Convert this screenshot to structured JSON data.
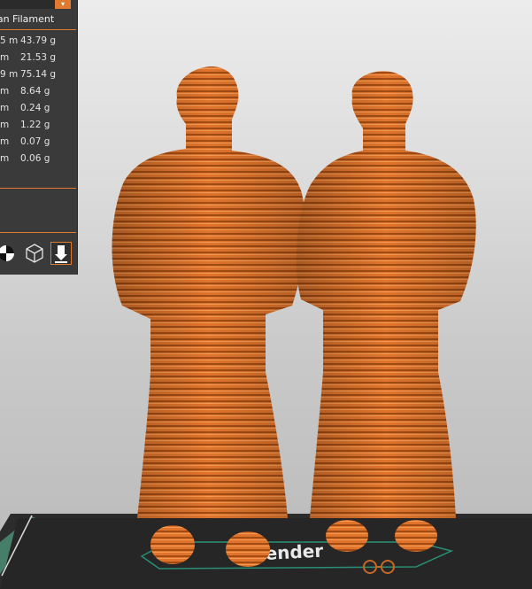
{
  "panel": {
    "title": "Filament",
    "title_prefix": "milan",
    "rows": [
      {
        "length": "5 m",
        "weight": "43.79 g"
      },
      {
        "length": "m",
        "weight": "21.53 g"
      },
      {
        "length": "9 m",
        "weight": "75.14 g"
      },
      {
        "length": "m",
        "weight": "8.64 g"
      },
      {
        "length": "m",
        "weight": "0.24 g"
      },
      {
        "length": "m",
        "weight": "1.22 g"
      },
      {
        "length": "m",
        "weight": "0.07 g"
      },
      {
        "length": "m",
        "weight": "0.06 g"
      }
    ],
    "dropdown_glyph": "▾"
  },
  "toolbar": {
    "icons": [
      "center-of-mass-icon",
      "cube-wireframe-icon",
      "lay-flat-icon"
    ]
  },
  "colors": {
    "accent": "#e07a30",
    "model": "#e0742c",
    "panel_bg": "#3a3a3a"
  }
}
